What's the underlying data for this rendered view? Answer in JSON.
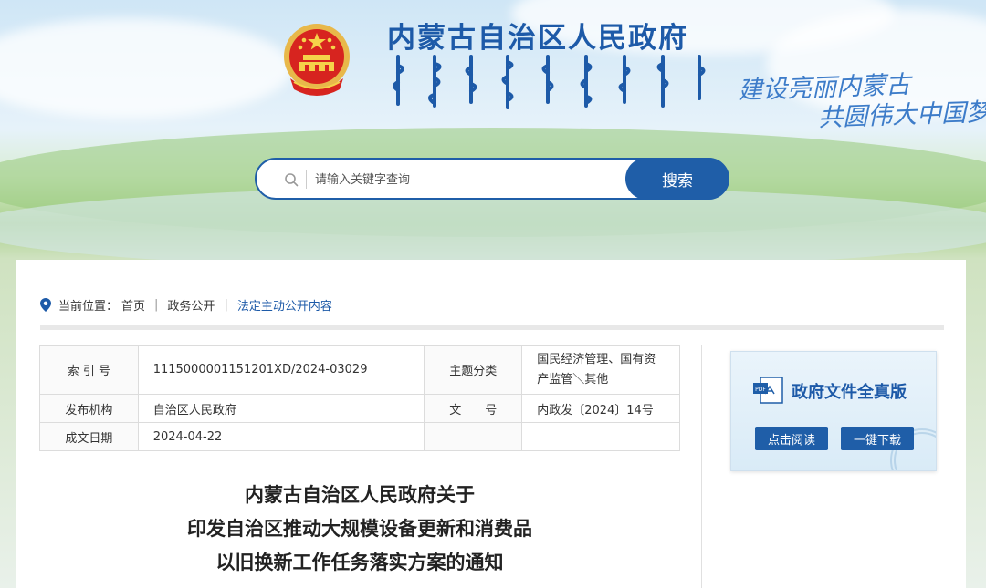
{
  "header": {
    "site_title": "内蒙古自治区人民政府",
    "slogan_line1": "建设亮丽内蒙古",
    "slogan_line2": "共圆伟大中国梦",
    "emblem_icon": "national-emblem-icon"
  },
  "search": {
    "placeholder": "请输入关键字查询",
    "button_label": "搜索",
    "icon": "search-icon"
  },
  "breadcrumb": {
    "label": "当前位置：",
    "items": [
      "首页",
      "政务公开",
      "法定主动公开内容"
    ],
    "separator": "|"
  },
  "info_table": {
    "index_label": "索 引 号",
    "index_value": "1115000001151201XD/2024-03029",
    "topic_label": "主题分类",
    "topic_value": "国民经济管理、国有资产监管＼其他",
    "issuer_label": "发布机构",
    "issuer_value": "自治区人民政府",
    "docno_label": "文　　号",
    "docno_value": "内政发〔2024〕14号",
    "date_label": "成文日期",
    "date_value": "2024-04-22"
  },
  "pdf_card": {
    "title": "政府文件全真版",
    "read_label": "点击阅读",
    "download_label": "一键下载",
    "icon": "pdf-file-icon"
  },
  "document": {
    "title_line1": "内蒙古自治区人民政府关于",
    "title_line2": "印发自治区推动大规模设备更新和消费品",
    "title_line3": "以旧换新工作任务落实方案的通知"
  },
  "colors": {
    "primary": "#1f5ea8",
    "title_blue": "#1d5aa8",
    "slogan_blue": "#3d7cc9"
  }
}
